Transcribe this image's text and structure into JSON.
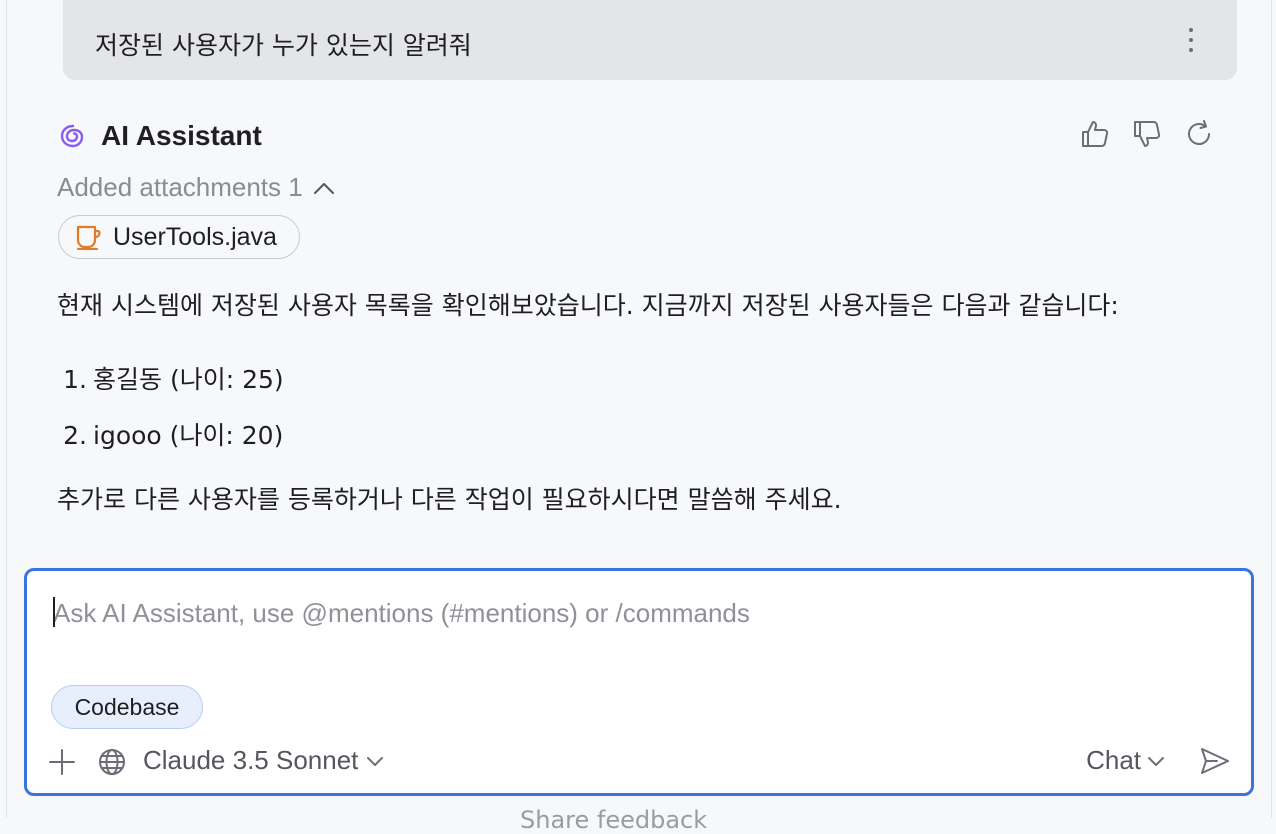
{
  "user_message": {
    "text": "저장된 사용자가 누가 있는지 알려줘"
  },
  "assistant": {
    "name": "AI Assistant",
    "attachments_label": "Added attachments 1",
    "attachment_file": "UserTools.java",
    "intro": "현재 시스템에 저장된 사용자 목록을 확인해보았습니다. 지금까지 저장된 사용자들은 다음과 같습니다:",
    "users": [
      {
        "num": "1.",
        "text": "홍길동 (나이: 25)"
      },
      {
        "num": "2.",
        "text": "igooo (나이: 20)"
      }
    ],
    "closing": "추가로 다른 사용자를 등록하거나 다른 작업이 필요하시다면 말씀해 주세요."
  },
  "composer": {
    "placeholder": "Ask AI Assistant, use @mentions (#mentions) or /commands",
    "context_chip": "Codebase",
    "model": "Claude 3.5 Sonnet",
    "mode": "Chat"
  },
  "footer_hint": "Share feedback",
  "colors": {
    "accent": "#3b74e0",
    "logo": "#8b5cf6",
    "java_icon": "#e07b2a"
  }
}
